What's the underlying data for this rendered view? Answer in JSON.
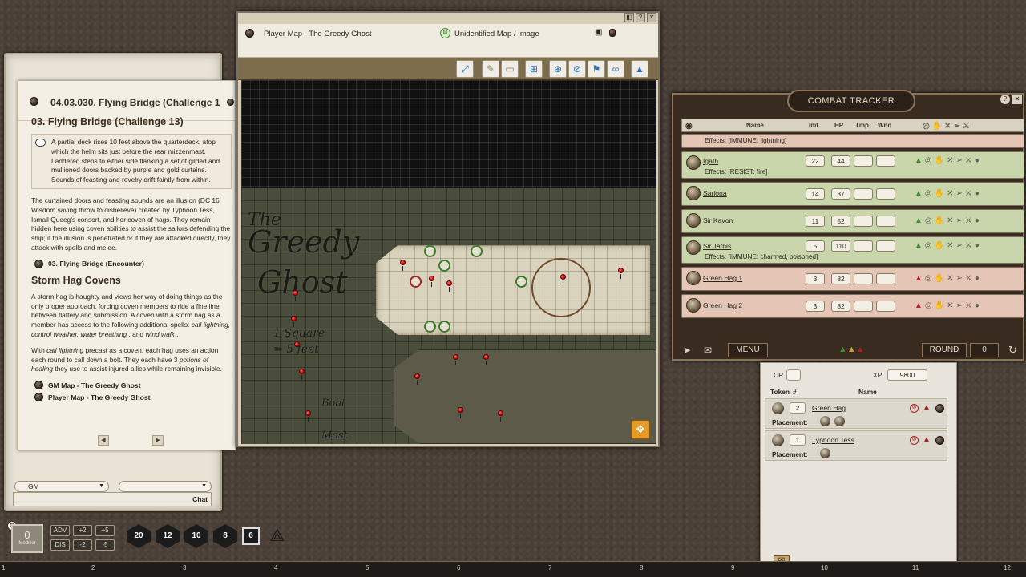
{
  "story": {
    "title": "04.03.030. Flying Bridge (Challenge 1",
    "heading": "03. Flying Bridge (Challenge 13)",
    "boxed_text": "A partial deck rises 10 feet above the quarterdeck, atop which the helm sits just before the rear mizzenmast. Laddered steps to either side flanking a set of gilded and mullioned doors backed by purple and gold curtains. Sounds of feasting and revelry drift faintly from within.",
    "para1": "The curtained doors and feasting sounds are an illusion (DC 16 Wisdom saving throw to disbelieve) created by Typhoon Tess, Ismail Queeg's consort, and her coven of hags. They remain hidden here using coven abilities to assist the sailors defending the ship; if the illusion is penetrated or if they are attacked directly, they attack with spells and melee.",
    "link1": "03. Flying Bridge (Encounter)",
    "heading2": "Storm Hag Covens",
    "para2_a": "A storm hag is haughty and views her way of doing things as the only proper approach, forcing coven members to ride a fine line between flattery and submission. A coven with a storm hag as a member has access to the following additional spells: ",
    "para2_spells": "call lightning, control weather, water breathing",
    "para2_and": " , and ",
    "para2_last": "wind walk",
    "para2_end": " .",
    "para3_a": "With ",
    "para3_spell": "call lightning",
    "para3_b": " precast as a coven, each hag uses an action each round to call down a bolt. They each have 3 ",
    "para3_item": "potions of healing",
    "para3_c": " they use to assist injured allies while remaining invisible.",
    "link2": "GM Map - The Greedy Ghost",
    "link3": "Player Map - The Greedy Ghost",
    "prev_arrow": "◀",
    "next_arrow": "▶"
  },
  "chat": {
    "identity_select": "GM",
    "language_select": "",
    "chat_button": "Chat"
  },
  "map_window": {
    "title": "Player Map - The Greedy Ghost",
    "status_badge": "ID",
    "status": "Unidentified Map / Image",
    "map_labels": {
      "the": "The",
      "greedy": "Greedy",
      "ghost": "Ghost",
      "square": "1 Square",
      "feet": "= 5 feet",
      "boat": "Boat",
      "mast": "Mast"
    },
    "toolbar_icons": [
      "expand-icon",
      "pencil-icon",
      "eraser-icon",
      "grid-icon",
      "target-icon",
      "no-target-icon",
      "flag-icon",
      "link-icon",
      "lock-icon"
    ],
    "window_controls": [
      "◧",
      "?",
      "✕"
    ]
  },
  "combat_tracker": {
    "title": "COMBAT TRACKER",
    "columns": {
      "name": "Name",
      "init": "Init",
      "hp": "HP",
      "tmp": "Tmp",
      "wnd": "Wnd"
    },
    "top_effect": "Effects: [IMMUNE: lightning]",
    "rows": [
      {
        "name": "Igath",
        "init": "22",
        "hp": "44",
        "effects": "Effects: [RESIST: fire]",
        "side": "friend"
      },
      {
        "name": "Sarlona",
        "init": "14",
        "hp": "37",
        "effects": "",
        "side": "friend"
      },
      {
        "name": "Sir Kavon",
        "init": "11",
        "hp": "52",
        "effects": "",
        "side": "friend"
      },
      {
        "name": "Sir Tathis",
        "init": "5",
        "hp": "110",
        "effects": "Effects: [IMMUNE: charmed, poisoned]",
        "side": "friend"
      },
      {
        "name": "Green Hag 1",
        "init": "3",
        "hp": "82",
        "effects": "",
        "side": "foe"
      },
      {
        "name": "Green Hag 2",
        "init": "3",
        "hp": "82",
        "effects": "",
        "side": "foe"
      }
    ],
    "menu_label": "MENU",
    "round_label": "ROUND",
    "round_value": "0"
  },
  "encounter": {
    "cr_label": "CR",
    "cr_value": "",
    "xp_label": "XP",
    "xp_value": "9800",
    "col_token": "Token",
    "col_count": "#",
    "col_name": "Name",
    "rows": [
      {
        "count": "2",
        "name": "Green Hag",
        "placement_label": "Placement:"
      },
      {
        "count": "1",
        "name": "Typhoon Tess",
        "placement_label": "Placement:"
      }
    ]
  },
  "modifier": {
    "value": "0",
    "label": "Modifier"
  },
  "mod_buttons": [
    "ADV",
    "+2",
    "+5",
    "DIS",
    "-2",
    "-5"
  ],
  "dice": [
    "20",
    "12",
    "10",
    "8",
    "6"
  ],
  "hotkeys": [
    "1",
    "2",
    "3",
    "4",
    "5",
    "6",
    "7",
    "8",
    "9",
    "10",
    "11",
    "12"
  ],
  "colors": {
    "friend_row": "#c9d6ab",
    "foe_row": "#e5c6b6",
    "map_accent": "#2f6fb5",
    "pin": "#d10000"
  }
}
